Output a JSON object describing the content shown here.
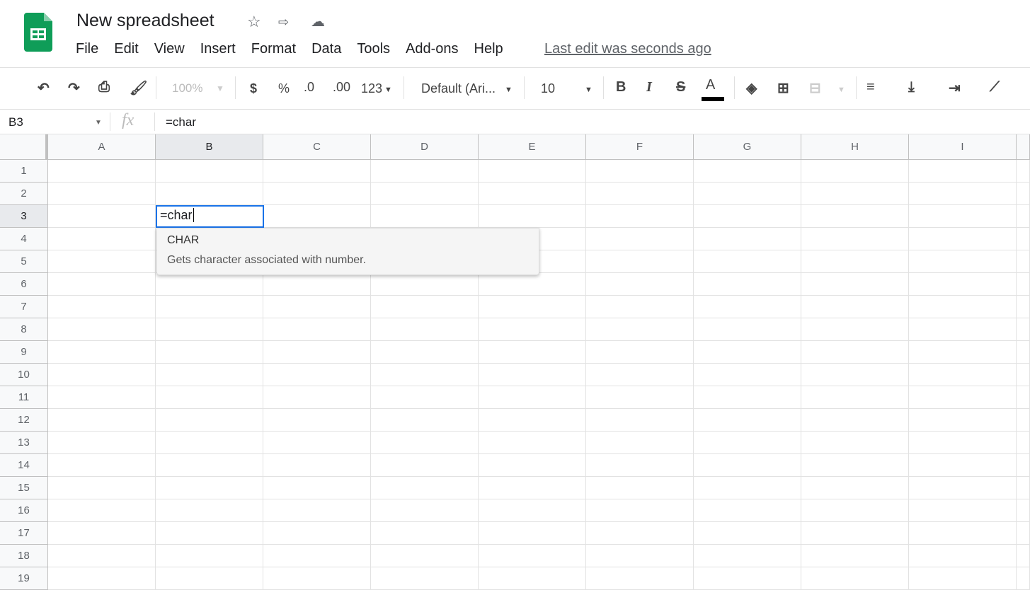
{
  "app": {
    "title": "New spreadsheet",
    "last_edit": "Last edit was seconds ago",
    "brand_color": "#0f9d58"
  },
  "menu": [
    "File",
    "Edit",
    "View",
    "Insert",
    "Format",
    "Data",
    "Tools",
    "Add-ons",
    "Help"
  ],
  "toolbar": {
    "zoom": "100%",
    "currency": "$",
    "percent": "%",
    "decrease_decimal": ".0",
    "increase_decimal": ".00",
    "more_formats": "123",
    "font": "Default (Ari...",
    "font_size": "10",
    "bold": "B",
    "italic": "I",
    "strikethrough": "S",
    "text_color": "A"
  },
  "formula_bar": {
    "name_box": "B3",
    "fx": "fx",
    "value": "=char"
  },
  "columns": [
    "A",
    "B",
    "C",
    "D",
    "E",
    "F",
    "G",
    "H",
    "I"
  ],
  "rows": [
    "1",
    "2",
    "3",
    "4",
    "5",
    "6",
    "7",
    "8",
    "9",
    "10",
    "11",
    "12",
    "13",
    "14",
    "15",
    "16",
    "17",
    "18",
    "19"
  ],
  "selected": {
    "column": "B",
    "row": "3"
  },
  "editor": {
    "value": "=char"
  },
  "autocomplete": {
    "name": "CHAR",
    "description": "Gets character associated with number."
  }
}
